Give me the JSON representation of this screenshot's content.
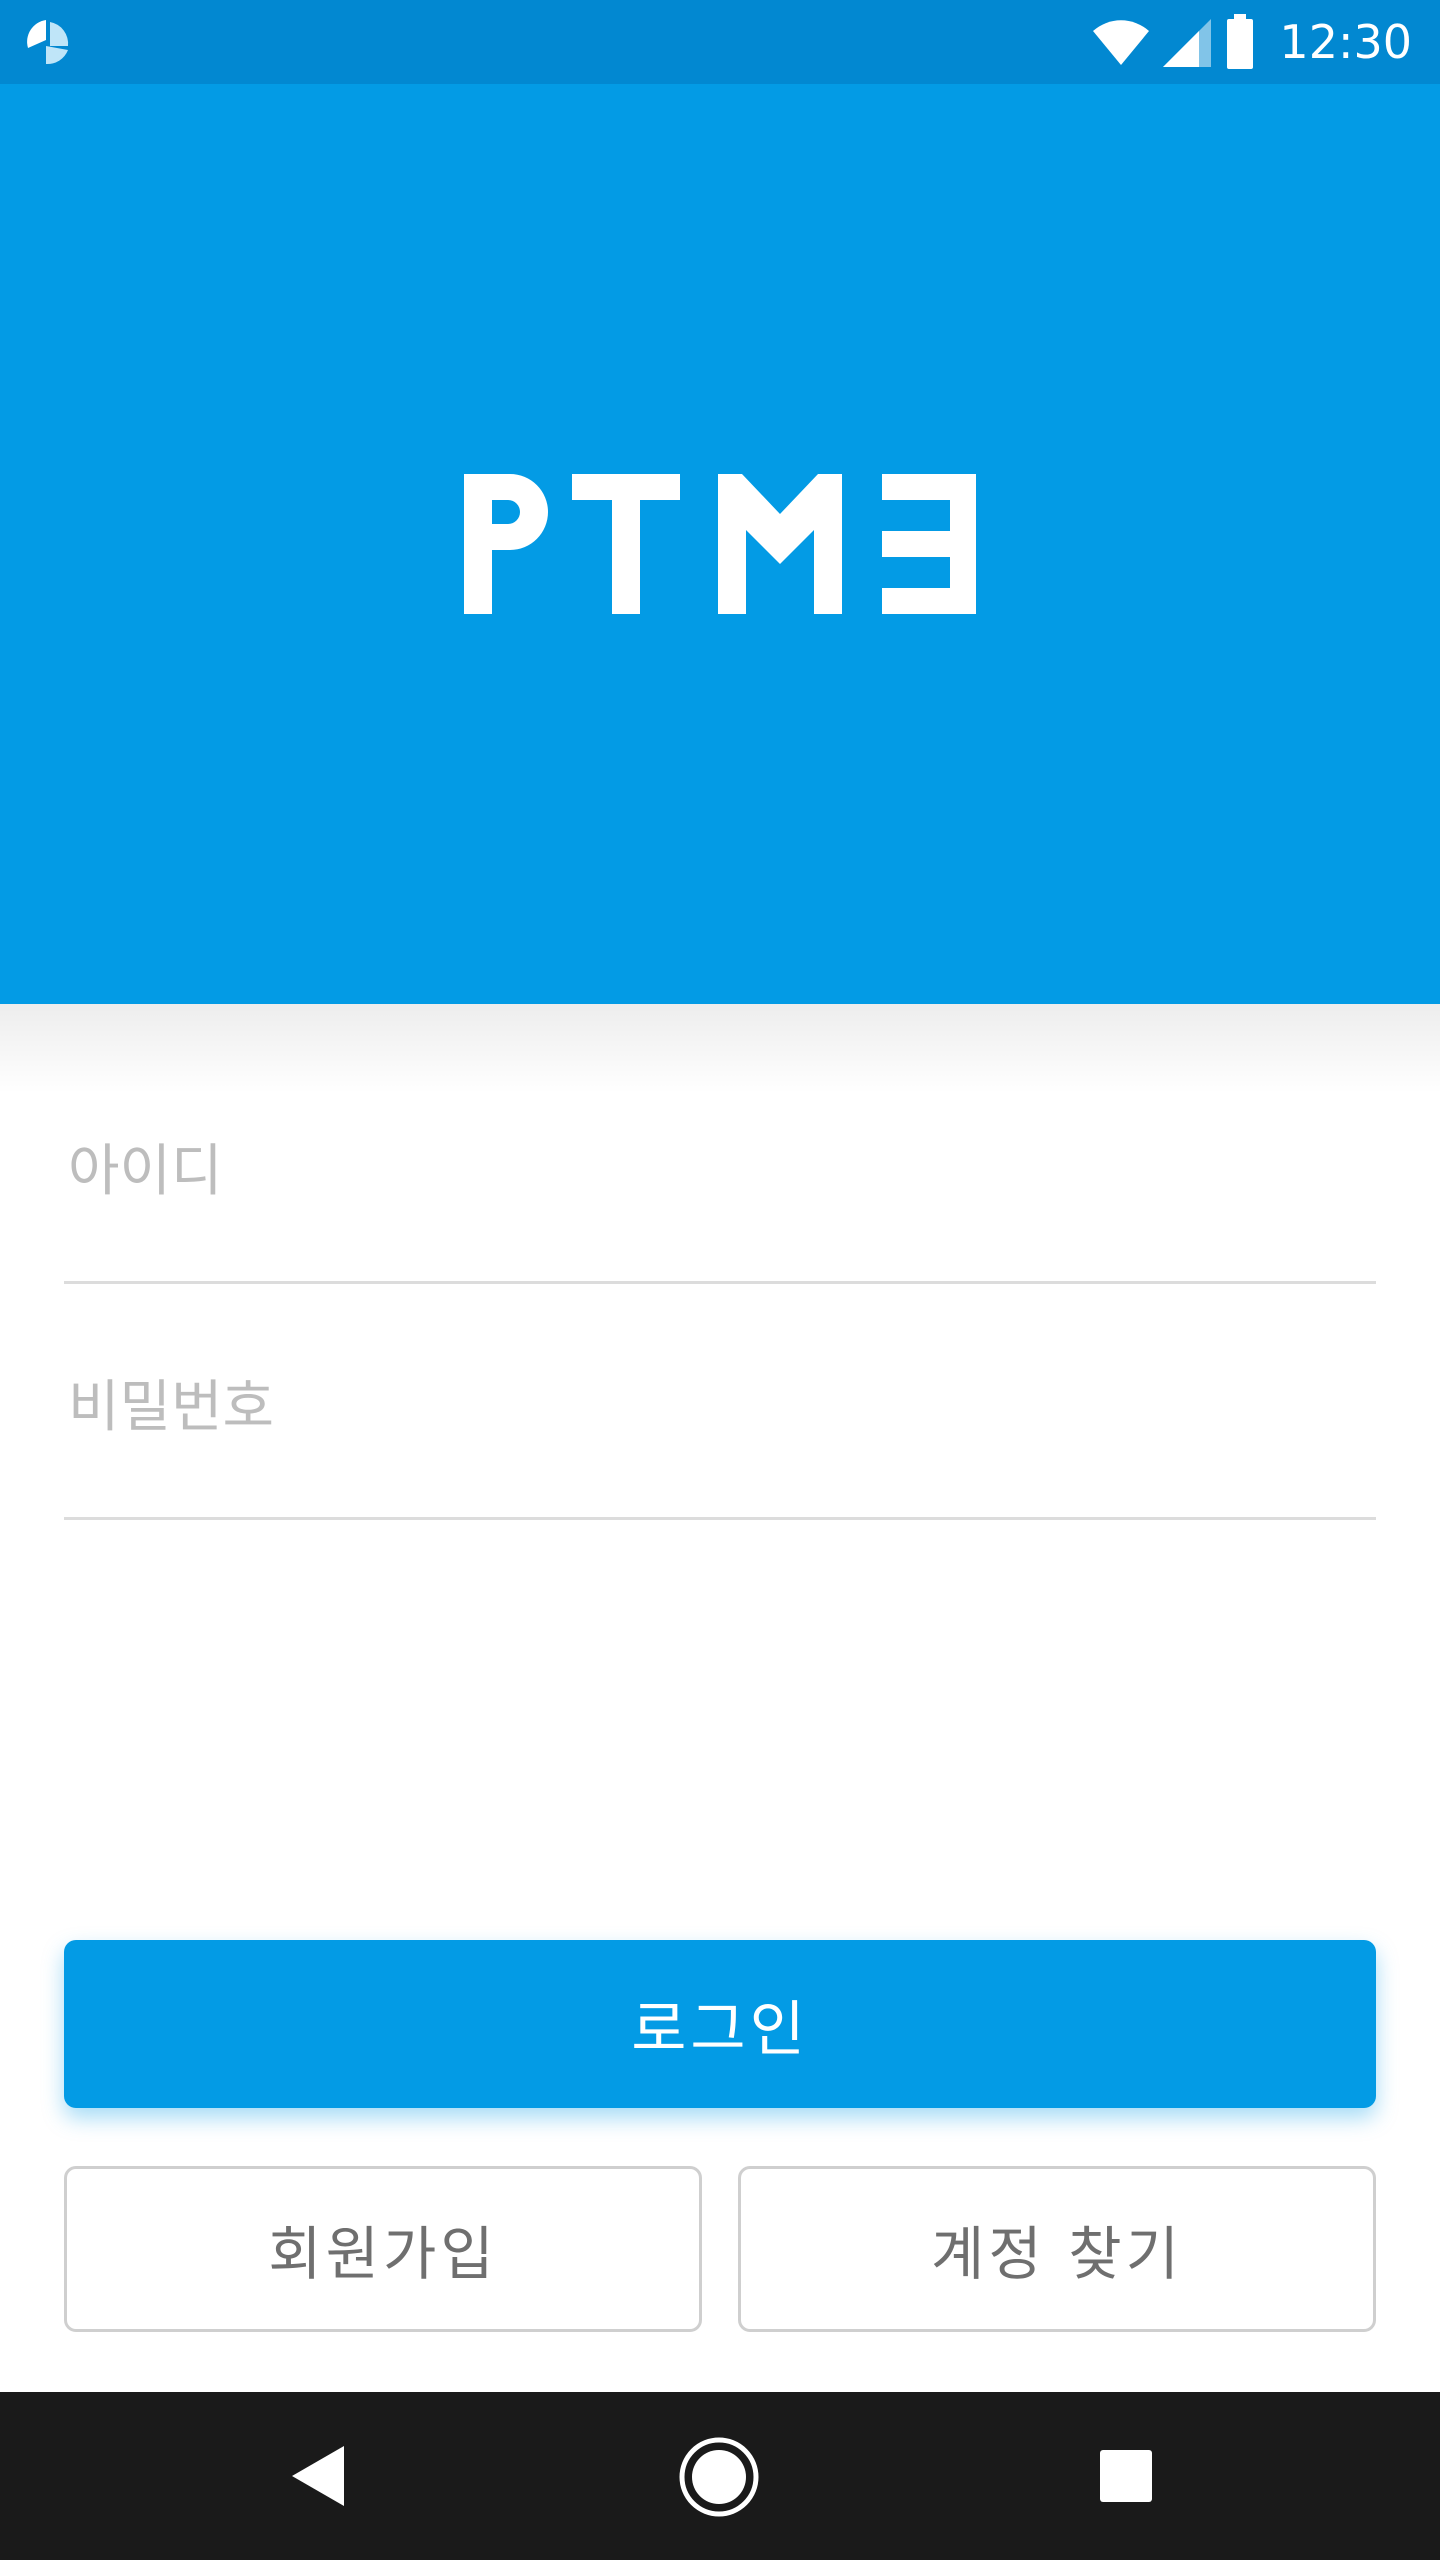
{
  "status_bar": {
    "time": "12:30",
    "app_icon": "pie-chart-icon",
    "icons": [
      "wifi-icon",
      "signal-icon",
      "battery-icon"
    ]
  },
  "header": {
    "logo_text": "PTME",
    "background_color": "#039be5"
  },
  "form": {
    "id_placeholder": "아이디",
    "id_value": "",
    "password_placeholder": "비밀번호",
    "password_value": ""
  },
  "buttons": {
    "login_label": "로그인",
    "signup_label": "회원가입",
    "find_account_label": "계정 찾기"
  },
  "nav_bar": {
    "icons": [
      "back-icon",
      "home-icon",
      "recent-apps-icon"
    ]
  }
}
